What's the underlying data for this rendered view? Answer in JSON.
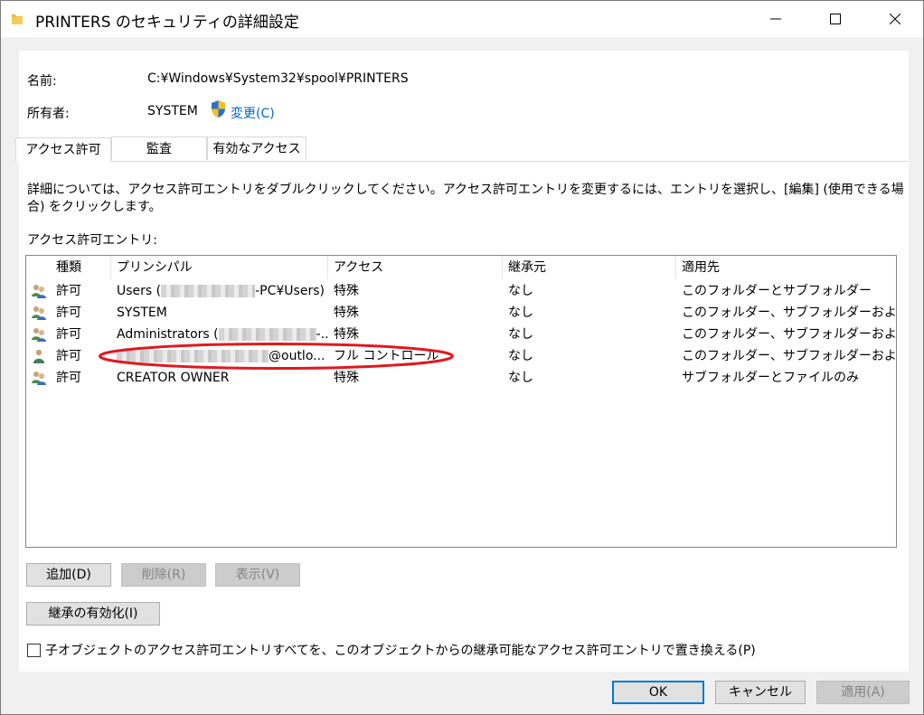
{
  "window": {
    "title": "PRINTERS のセキュリティの詳細設定"
  },
  "info": {
    "name_label": "名前:",
    "name_value": "C:¥Windows¥System32¥spool¥PRINTERS",
    "owner_label": "所有者:",
    "owner_value": "SYSTEM",
    "change_link": "変更(C)"
  },
  "tabs": [
    {
      "label": "アクセス許可",
      "active": true
    },
    {
      "label": "監査",
      "active": false
    },
    {
      "label": "有効なアクセス",
      "active": false
    }
  ],
  "description": "詳細については、アクセス許可エントリをダブルクリックしてください。アクセス許可エントリを変更するには、エントリを選択し、[編集] (使用できる場合) をクリックします。",
  "entries_label": "アクセス許可エントリ:",
  "columns": [
    "種類",
    "プリンシパル",
    "アクセス",
    "継承元",
    "適用先"
  ],
  "rows": [
    {
      "icon": "users-group-icon",
      "type": "許可",
      "principal_prefix": "Users (",
      "principal_suffix": "-PC¥Users)",
      "access": "特殊",
      "inherited": "なし",
      "applies": "このフォルダーとサブフォルダー"
    },
    {
      "icon": "users-group-icon",
      "type": "許可",
      "principal_prefix": "SYSTEM",
      "principal_suffix": "",
      "access": "特殊",
      "inherited": "なし",
      "applies": "このフォルダー、サブフォルダーおよびファ..."
    },
    {
      "icon": "users-group-icon",
      "type": "許可",
      "principal_prefix": "Administrators (",
      "principal_suffix": "-...",
      "access": "特殊",
      "inherited": "なし",
      "applies": "このフォルダー、サブフォルダーおよびファ..."
    },
    {
      "icon": "single-user-icon",
      "type": "許可",
      "principal_prefix": "",
      "principal_suffix": "@outlo...",
      "access": "フル コントロール",
      "inherited": "なし",
      "applies": "このフォルダー、サブフォルダーおよびファ..."
    },
    {
      "icon": "users-group-icon",
      "type": "許可",
      "principal_prefix": "CREATOR OWNER",
      "principal_suffix": "",
      "access": "特殊",
      "inherited": "なし",
      "applies": "サブフォルダーとファイルのみ"
    }
  ],
  "buttons": {
    "add": "追加(D)",
    "remove": "削除(R)",
    "view": "表示(V)",
    "enable_inheritance": "継承の有効化(I)",
    "ok": "OK",
    "cancel": "キャンセル",
    "apply": "適用(A)"
  },
  "replace_checkbox_label": "子オブジェクトのアクセス許可エントリすべてを、このオブジェクトからの継承可能なアクセス許可エントリで置き換える(P)",
  "colors": {
    "link": "#0066cc",
    "highlight_ellipse": "#e0191f",
    "default_button_border": "#0078d7"
  }
}
